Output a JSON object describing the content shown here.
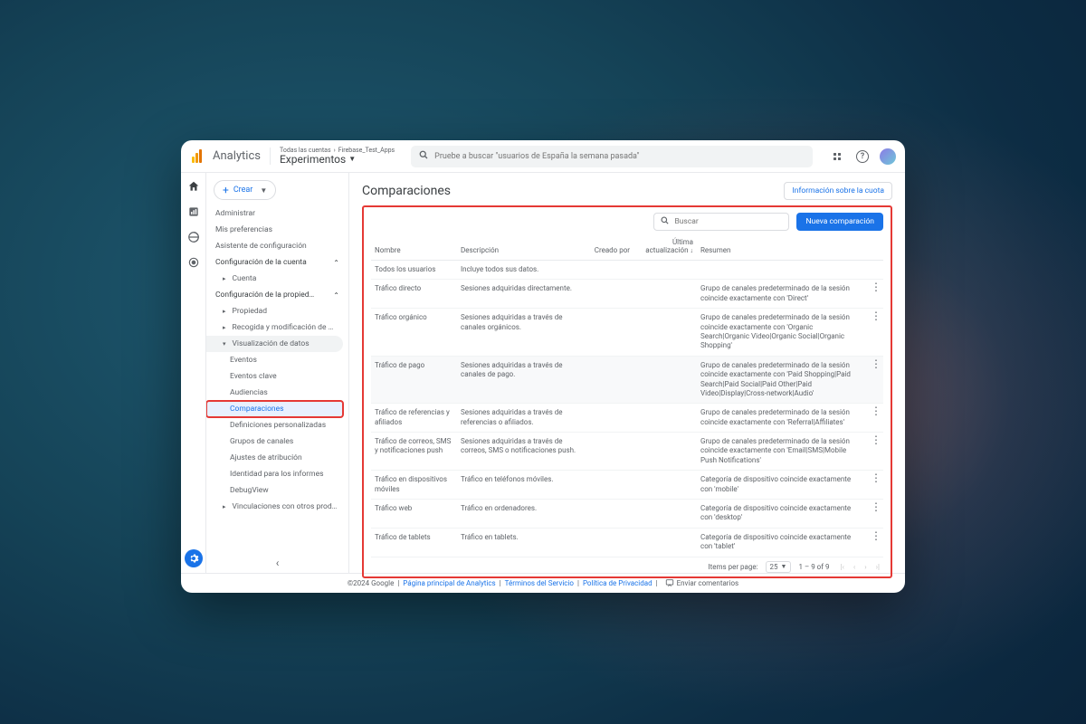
{
  "header": {
    "brand": "Analytics",
    "breadcrumb_root": "Todas las cuentas",
    "breadcrumb_leaf": "Firebase_Test_Apps",
    "current_view": "Experimentos",
    "search_placeholder": "Pruebe a buscar \"usuarios de España la semana pasada\""
  },
  "create_label": "Crear",
  "sidebar": {
    "administrar": "Administrar",
    "prefs": "Mis preferencias",
    "asist": "Asistente de configuración",
    "sec_cuenta": "Configuración de la cuenta",
    "cuenta": "Cuenta",
    "sec_prop": "Configuración de la propied…",
    "propiedad": "Propiedad",
    "recogida": "Recogida y modificación de …",
    "vis": "Visualización de datos",
    "eventos": "Eventos",
    "eventos_clave": "Eventos clave",
    "audiencias": "Audiencias",
    "comparaciones": "Comparaciones",
    "def_pers": "Definiciones personalizadas",
    "grupos": "Grupos de canales",
    "ajustes_atrib": "Ajustes de atribución",
    "identidad": "Identidad para los informes",
    "debug": "DebugView",
    "vinculaciones": "Vinculaciones con otros prod…"
  },
  "page": {
    "title": "Comparaciones",
    "quota_link": "Información sobre la cuota",
    "search_placeholder": "Buscar",
    "new_button": "Nueva comparación",
    "columns": {
      "name": "Nombre",
      "desc": "Descripción",
      "creator": "Creado por",
      "updated": "Última actualización",
      "summary": "Resumen"
    },
    "rows": [
      {
        "name": "Todos los usuarios",
        "desc": "Incluye todos sus datos.",
        "summary": ""
      },
      {
        "name": "Tráfico directo",
        "desc": "Sesiones adquiridas directamente.",
        "summary": "Grupo de canales predeterminado de la sesión coincide exactamente con 'Direct'"
      },
      {
        "name": "Tráfico orgánico",
        "desc": "Sesiones adquiridas a través de canales orgánicos.",
        "summary": "Grupo de canales predeterminado de la sesión coincide exactamente con 'Organic Search|Organic Video|Organic Social|Organic Shopping'"
      },
      {
        "name": "Tráfico de pago",
        "desc": "Sesiones adquiridas a través de canales de pago.",
        "summary": "Grupo de canales predeterminado de la sesión coincide exactamente con 'Paid Shopping|Paid Search|Paid Social|Paid Other|Paid Video|Display|Cross-network|Audio'",
        "hover": true
      },
      {
        "name": "Tráfico de referencias y afiliados",
        "desc": "Sesiones adquiridas a través de referencias o afiliados.",
        "summary": "Grupo de canales predeterminado de la sesión coincide exactamente con 'Referral|Affiliates'"
      },
      {
        "name": "Tráfico de correos, SMS y notificaciones push",
        "desc": "Sesiones adquiridas a través de correos, SMS o notificaciones push.",
        "summary": "Grupo de canales predeterminado de la sesión coincide exactamente con 'Email|SMS|Mobile Push Notifications'"
      },
      {
        "name": "Tráfico en dispositivos móviles",
        "desc": "Tráfico en teléfonos móviles.",
        "summary": "Categoría de dispositivo coincide exactamente con 'mobile'"
      },
      {
        "name": "Tráfico web",
        "desc": "Tráfico en ordenadores.",
        "summary": "Categoría de dispositivo coincide exactamente con 'desktop'"
      },
      {
        "name": "Tráfico de tablets",
        "desc": "Tráfico en tablets.",
        "summary": "Categoría de dispositivo coincide exactamente con 'tablet'"
      }
    ],
    "pager": {
      "items_label": "Items per page:",
      "page_size": "25",
      "range": "1 – 9 of 9"
    }
  },
  "footer": {
    "copyright": "©2024 Google",
    "home": "Página principal de Analytics",
    "terms": "Términos del Servicio",
    "privacy": "Política de Privacidad",
    "feedback": "Enviar comentarios"
  }
}
